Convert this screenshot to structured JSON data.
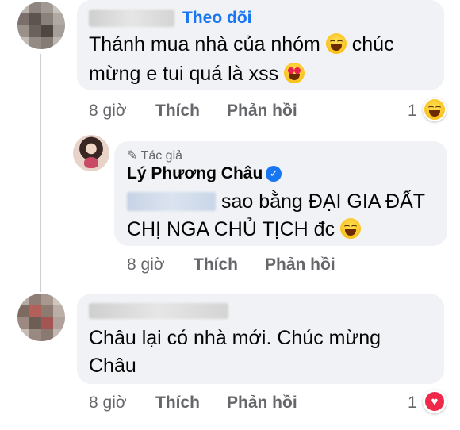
{
  "comment1": {
    "follow_label": "Theo dõi",
    "text_line1": "Thánh mua nhà của nhóm",
    "text_line1b": "chúc",
    "text_line2": "mừng e tui quá là xss",
    "time": "8 giờ",
    "like": "Thích",
    "reply": "Phản hồi",
    "reaction_count": "1",
    "reaction_icon": "laughing-emoji"
  },
  "reply1": {
    "badge": "Tác giả",
    "author": "Lý Phương Châu",
    "text_line1": "sao bằng ĐẠI GIA ĐẤT",
    "text_line2": "CHỊ NGA CHỦ TỊCH đc",
    "time": "8 giờ",
    "like": "Thích",
    "reply": "Phản hồi"
  },
  "comment2": {
    "text_line1": "Châu lại có nhà mới. Chúc mừng",
    "text_line2": "Châu",
    "time": "8 giờ",
    "like": "Thích",
    "reply": "Phản hồi",
    "reaction_count": "1",
    "reaction_icon": "heart-icon"
  },
  "colors": {
    "bubble": "#f0f2f5",
    "link": "#1876f2",
    "meta": "#65676b",
    "heart": "#f02849"
  }
}
